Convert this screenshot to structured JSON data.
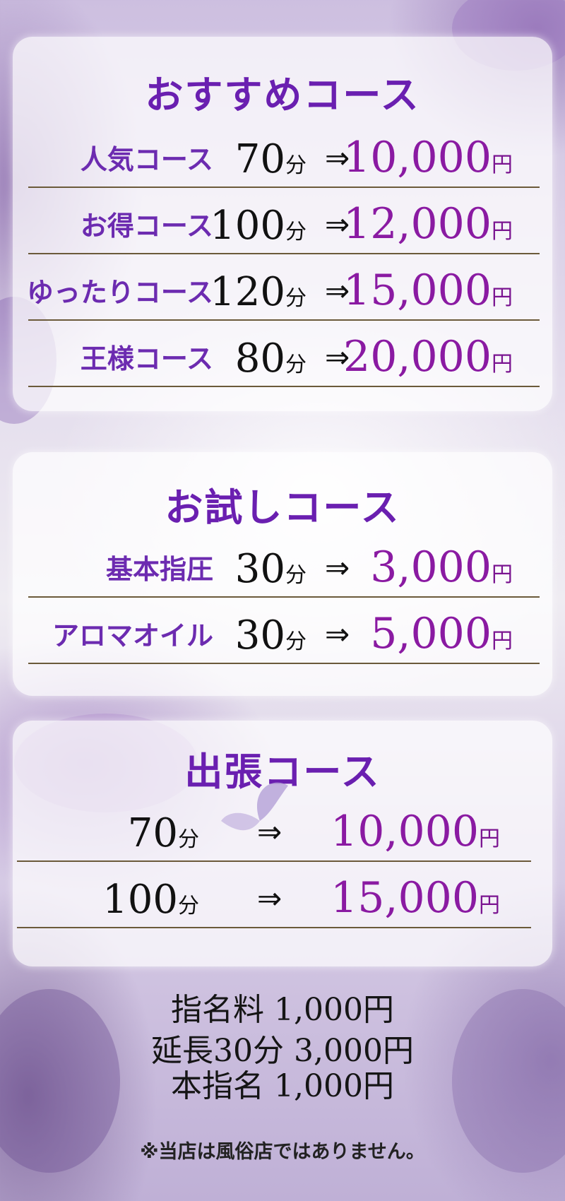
{
  "sections": [
    {
      "title": "おすすめコース",
      "rows": [
        {
          "name": "人気コース",
          "minutes": "70",
          "unit": "分",
          "arrow": "⇒",
          "price": "10,000",
          "yen": "円"
        },
        {
          "name": "お得コース",
          "minutes": "100",
          "unit": "分",
          "arrow": "⇒",
          "price": "12,000",
          "yen": "円"
        },
        {
          "name": "ゆったりコース",
          "minutes": "120",
          "unit": "分",
          "arrow": "⇒",
          "price": "15,000",
          "yen": "円"
        },
        {
          "name": "王様コース",
          "minutes": "80",
          "unit": "分",
          "arrow": "⇒",
          "price": "20,000",
          "yen": "円"
        }
      ]
    },
    {
      "title": "お試しコース",
      "rows": [
        {
          "name": "基本指圧",
          "minutes": "30",
          "unit": "分",
          "arrow": "⇒",
          "price": "3,000",
          "yen": "円"
        },
        {
          "name": "アロマオイル",
          "minutes": "30",
          "unit": "分",
          "arrow": "⇒",
          "price": "5,000",
          "yen": "円"
        }
      ]
    },
    {
      "title": "出張コース",
      "rows": [
        {
          "minutes": "70",
          "unit": "分",
          "arrow": "⇒",
          "price": "10,000",
          "yen": "円"
        },
        {
          "minutes": "100",
          "unit": "分",
          "arrow": "⇒",
          "price": "15,000",
          "yen": "円"
        }
      ]
    }
  ],
  "fees": [
    "指名料 1,000円",
    "延長30分 3,000円",
    "本指名 1,000円"
  ],
  "notice": "※当店は風俗店ではありません。",
  "colors": {
    "title": "#6a1fb0",
    "price": "#8a1aa2",
    "row_name": "#6c2bb0"
  }
}
